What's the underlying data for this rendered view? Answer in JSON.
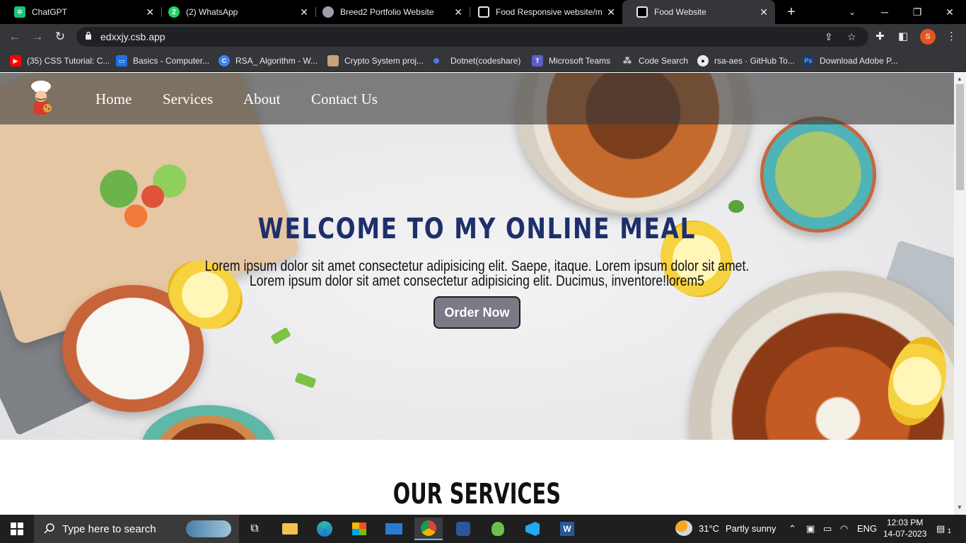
{
  "browser": {
    "tabs": [
      {
        "title": "ChatGPT",
        "icon": "chatgpt-icon"
      },
      {
        "title": "(2) WhatsApp",
        "icon": "whatsapp-icon"
      },
      {
        "title": "Breed2 Portfolio Website",
        "icon": "globe-icon"
      },
      {
        "title": "Food Responsive website/ma",
        "icon": "codesandbox-icon"
      },
      {
        "title": "Food Website",
        "icon": "codesandbox-icon",
        "active": true
      }
    ],
    "new_tab": "+",
    "url": "edxxjy.csb.app",
    "profile_initial": "S",
    "bookmarks": [
      {
        "label": "(35) CSS Tutorial: C...",
        "icon": "youtube-icon"
      },
      {
        "label": "Basics - Computer...",
        "icon": "bookmark-icon"
      },
      {
        "label": "RSA_ Algorithm - W...",
        "icon": "c-icon"
      },
      {
        "label": "Crypto System proj...",
        "icon": "image-icon"
      },
      {
        "label": "Dotnet(codeshare)",
        "icon": "dot-icon"
      },
      {
        "label": "Microsoft Teams",
        "icon": "teams-icon"
      },
      {
        "label": "Code Search",
        "icon": "code-search-icon"
      },
      {
        "label": "rsa-aes · GitHub To...",
        "icon": "github-icon"
      },
      {
        "label": "Download Adobe P...",
        "icon": "adobe-icon"
      }
    ]
  },
  "page": {
    "nav": [
      "Home",
      "Services",
      "About",
      "Contact Us"
    ],
    "hero": {
      "title": "WELCOME TO MY ONLINE MEAL",
      "line1": "Lorem ipsum dolor sit amet consectetur adipisicing elit. Saepe, itaque. Lorem ipsum dolor sit amet.",
      "line2": "Lorem ipsum dolor sit amet consectetur adipisicing elit. Ducimus, inventore!lorem5",
      "button": "Order Now"
    },
    "services_title": "OUR SERVICES"
  },
  "taskbar": {
    "search_placeholder": "Type here to search",
    "weather_temp": "31°C",
    "weather_text": "Partly sunny",
    "language": "ENG",
    "time": "12:03 PM",
    "date": "14-07-2023",
    "notification_count": "1"
  },
  "colors": {
    "hero_title": "#1e2f6b",
    "order_button": "#7c7a86",
    "tab_bar": "#000000",
    "toolbar": "#35363a"
  }
}
